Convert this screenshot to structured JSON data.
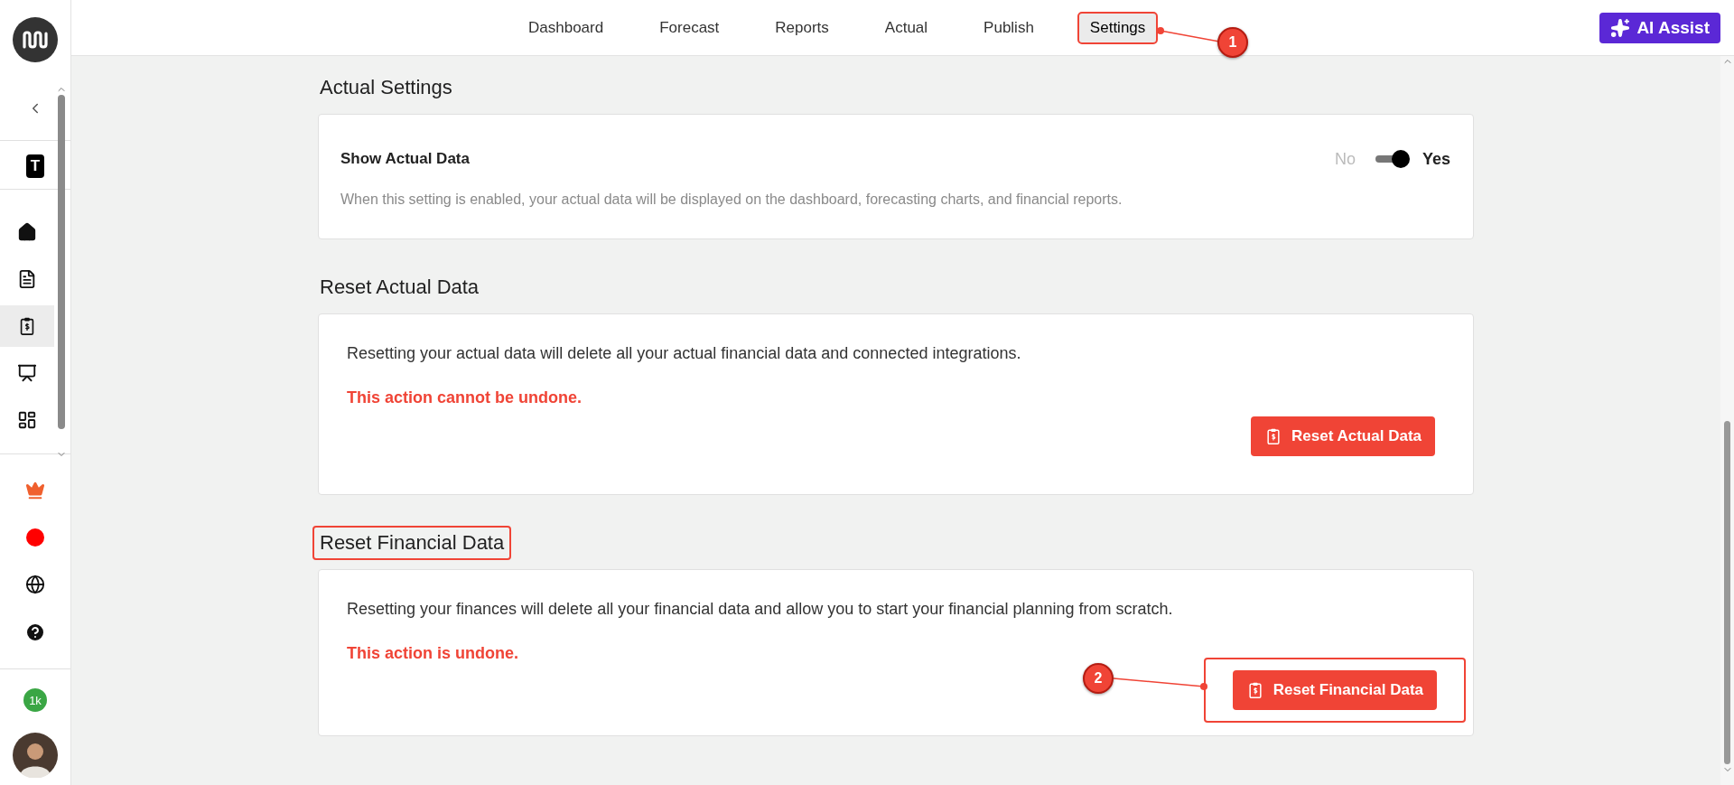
{
  "sidebar": {
    "logo": {
      "kind": "logo"
    },
    "workspace": "T",
    "items": [
      {
        "kind": "home",
        "selected": false
      },
      {
        "kind": "document",
        "selected": false
      },
      {
        "kind": "clipboard",
        "selected": true
      },
      {
        "kind": "presentation",
        "selected": false
      },
      {
        "kind": "layout",
        "selected": false
      }
    ],
    "extras": [
      {
        "kind": "crown"
      },
      {
        "kind": "record"
      },
      {
        "kind": "globe"
      },
      {
        "kind": "help"
      }
    ],
    "badge": "1k"
  },
  "nav": {
    "tabs": [
      {
        "label": "Dashboard",
        "selected": false,
        "highlighted": false
      },
      {
        "label": "Forecast",
        "selected": false,
        "highlighted": false
      },
      {
        "label": "Reports",
        "selected": false,
        "highlighted": false
      },
      {
        "label": "Actual",
        "selected": false,
        "highlighted": false
      },
      {
        "label": "Publish",
        "selected": false,
        "highlighted": false
      },
      {
        "label": "Settings",
        "selected": true,
        "highlighted": true
      }
    ],
    "assist_button": "AI Assist"
  },
  "sections": [
    {
      "kind": "toggle",
      "title": "Actual Settings",
      "highlighted": false,
      "setting": {
        "label": "Show Actual Data",
        "off_label": "No",
        "on_label": "Yes",
        "on": true,
        "description": "When this setting is enabled, your actual data will be displayed on the dashboard, forecasting charts, and financial reports."
      }
    },
    {
      "kind": "reset",
      "title": "Reset Actual Data",
      "highlighted": false,
      "text": "Resetting your actual data will delete all your actual financial data and connected integrations.",
      "warning": "This action cannot be undone.",
      "button": {
        "label": "Reset Actual Data",
        "highlighted": false
      }
    },
    {
      "kind": "reset",
      "title": "Reset Financial Data",
      "highlighted": true,
      "text": "Resetting your finances will delete all your financial data and allow you to start your financial planning from scratch.",
      "warning": "This action is undone.",
      "button": {
        "label": "Reset Financial Data",
        "highlighted": true
      }
    }
  ],
  "annotations": [
    {
      "number": "1"
    },
    {
      "number": "2"
    }
  ]
}
